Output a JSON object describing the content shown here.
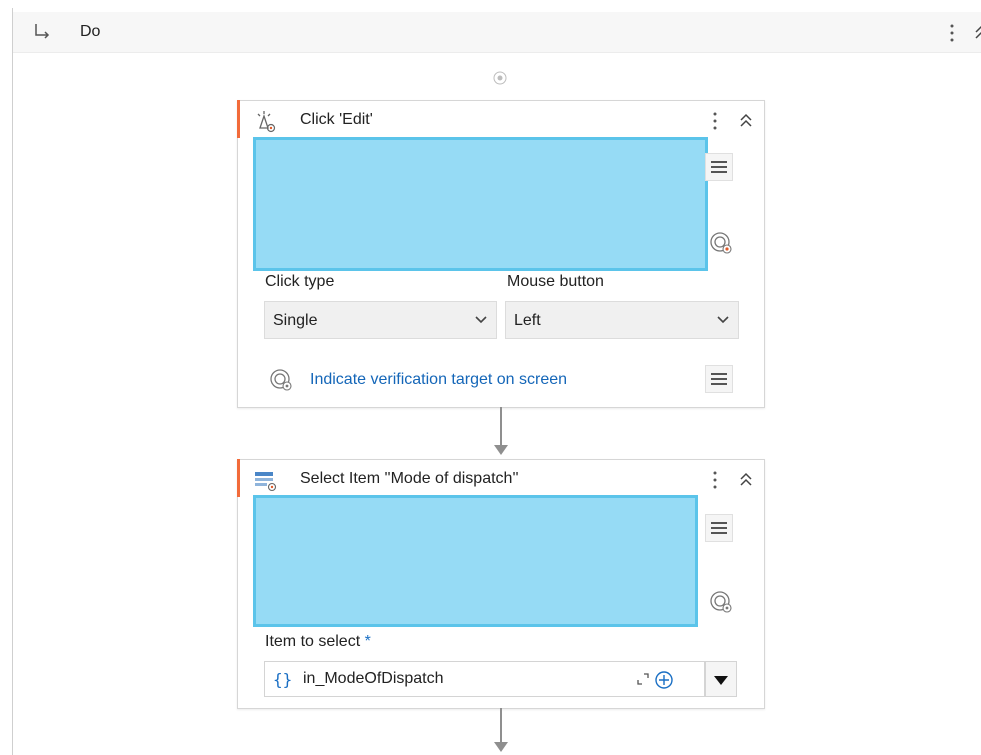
{
  "sequence": {
    "label": "Do"
  },
  "click_activity": {
    "title": "Click 'Edit'",
    "click_type": {
      "label": "Click type",
      "value": "Single"
    },
    "mouse_button": {
      "label": "Mouse button",
      "value": "Left"
    },
    "verification_link": "Indicate verification target on screen"
  },
  "select_activity": {
    "title": "Select Item ''Mode of dispatch''",
    "item_to_select": {
      "label": "Item to select",
      "required_mark": "*",
      "expr_prefix": "{}",
      "value": "in_ModeOfDispatch"
    }
  },
  "colors": {
    "accent": "#f26b3a",
    "target_fill": "#96dbf5",
    "target_border": "#5bc4ea",
    "link": "#1466b8"
  }
}
